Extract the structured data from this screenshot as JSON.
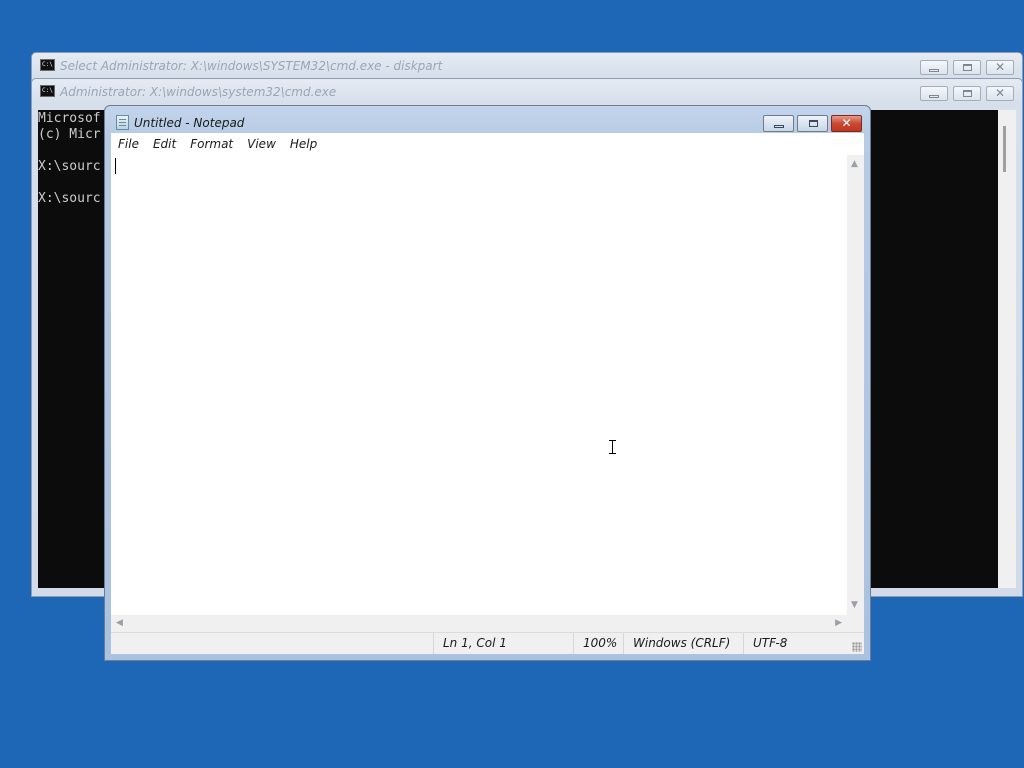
{
  "cmd_back": {
    "title": "Select Administrator: X:\\windows\\SYSTEM32\\cmd.exe - diskpart"
  },
  "cmd_front": {
    "title": "Administrator: X:\\windows\\system32\\cmd.exe",
    "lines": [
      "Microsof",
      "(c) Micr",
      "",
      "X:\\sourc",
      "",
      "X:\\sourc"
    ]
  },
  "notepad": {
    "title": "Untitled - Notepad",
    "menu": [
      "File",
      "Edit",
      "Format",
      "View",
      "Help"
    ],
    "content": "",
    "status": {
      "position": "Ln 1, Col 1",
      "zoom": "100%",
      "line_ending": "Windows (CRLF)",
      "encoding": "UTF-8"
    }
  },
  "icons": {
    "minimize": "minimize-icon",
    "maximize": "maximize-icon",
    "close": "close-icon"
  },
  "colors": {
    "desktop": "#1e67b6",
    "console_bg": "#0c0c0c",
    "close_button": "#c94a32"
  }
}
